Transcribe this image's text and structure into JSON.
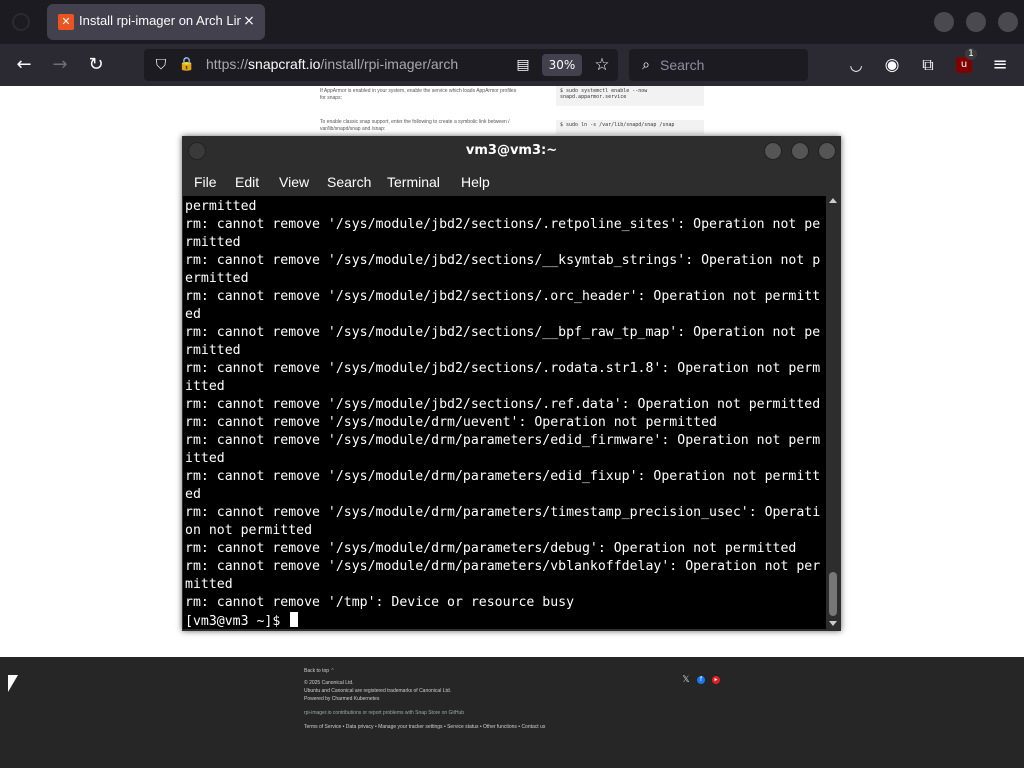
{
  "browser": {
    "tab": {
      "title": "Install rpi-imager on Arch Linux | Snap Store",
      "close": "×"
    },
    "url_prefix": "https://",
    "url_host": "snapcraft.io",
    "url_path": "/install/rpi-imager/arch",
    "zoom": "30%",
    "search_placeholder": "Search",
    "extension_badge": "1"
  },
  "page": {
    "lines": [
      "If AppArmor is enabled in your system, enable the service which loads AppArmor profiles",
      "for snaps:",
      "To enable classic snap support, enter the following to create a symbolic link between /",
      "var/lib/snapd/snap and /snap:"
    ],
    "code1": [
      "$ sudo systemctl enable --now",
      "  snapd.apparmor.service"
    ],
    "code2": "$ sudo ln -s /var/lib/snapd/snap /snap"
  },
  "footer": {
    "back_to_top": "Back to top ⌃",
    "lines": [
      "© 2025 Canonical Ltd.",
      "Ubuntu and Canonical are registered trademarks of Canonical Ltd.",
      "Powered by Charmed Kubernetes"
    ],
    "contribute": "rpi-imager.io contributions or report problems with Snap Store on GitHub",
    "links": "Terms of Service  •  Data privacy  •  Manage your tracker settings  •  Service status  •  Other functions  •  Contact us"
  },
  "terminal": {
    "title": "vm3@vm3:~",
    "menu": [
      "File",
      "Edit",
      "View",
      "Search",
      "Terminal",
      "Help"
    ],
    "lines": [
      "permitted",
      "rm: cannot remove '/sys/module/jbd2/sections/.retpoline_sites': Operation not pe",
      "rmitted",
      "rm: cannot remove '/sys/module/jbd2/sections/__ksymtab_strings': Operation not p",
      "ermitted",
      "rm: cannot remove '/sys/module/jbd2/sections/.orc_header': Operation not permitt",
      "ed",
      "rm: cannot remove '/sys/module/jbd2/sections/__bpf_raw_tp_map': Operation not pe",
      "rmitted",
      "rm: cannot remove '/sys/module/jbd2/sections/.rodata.str1.8': Operation not perm",
      "itted",
      "rm: cannot remove '/sys/module/jbd2/sections/.ref.data': Operation not permitted",
      "rm: cannot remove '/sys/module/drm/uevent': Operation not permitted",
      "rm: cannot remove '/sys/module/drm/parameters/edid_firmware': Operation not perm",
      "itted",
      "rm: cannot remove '/sys/module/drm/parameters/edid_fixup': Operation not permitt",
      "ed",
      "rm: cannot remove '/sys/module/drm/parameters/timestamp_precision_usec': Operati",
      "on not permitted",
      "rm: cannot remove '/sys/module/drm/parameters/debug': Operation not permitted",
      "rm: cannot remove '/sys/module/drm/parameters/vblankoffdelay': Operation not per",
      "mitted",
      "rm: cannot remove '/tmp': Device or resource busy"
    ],
    "prompt": "[vm3@vm3 ~]$ "
  }
}
